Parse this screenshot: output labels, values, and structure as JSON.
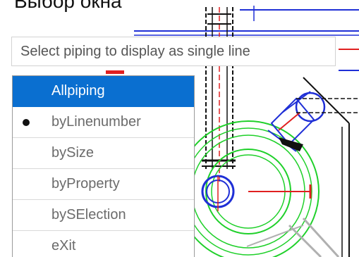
{
  "caption": "Выбор окна",
  "prompt": {
    "text": "Select piping to display as single line"
  },
  "menu": {
    "items": [
      {
        "label": "Allpiping",
        "state": "highlighted"
      },
      {
        "label": "byLinenumber",
        "state": "selected"
      },
      {
        "label": "bySize"
      },
      {
        "label": "byProperty"
      },
      {
        "label": "bySElection"
      },
      {
        "label": "eXit"
      }
    ]
  },
  "colors": {
    "highlight": "#0a6fd0",
    "cad_blue": "#1f2fd6",
    "cad_green": "#1fd02a",
    "cad_red": "#e02020"
  },
  "icons": {
    "selected_marker": "bullet-icon"
  }
}
